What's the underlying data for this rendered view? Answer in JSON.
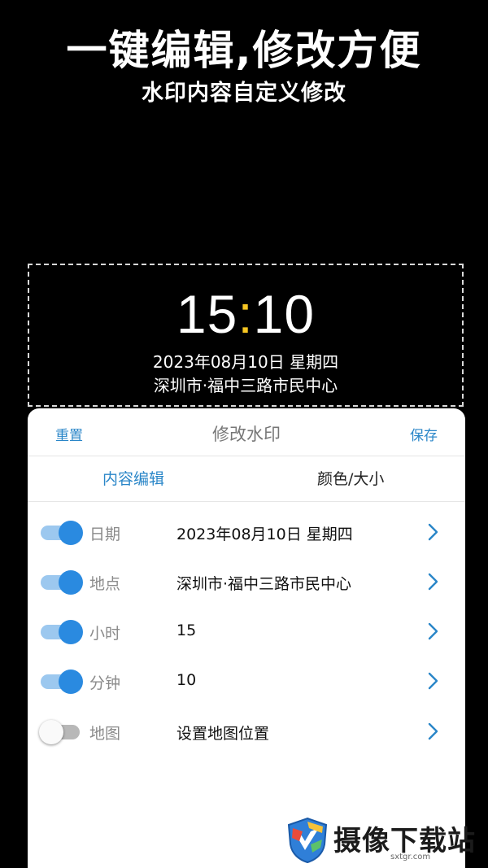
{
  "headline": "一键编辑,修改方便",
  "subheadline": "水印内容自定义修改",
  "preview": {
    "hour": "15",
    "colon": ":",
    "minute": "10",
    "date": "2023年08月10日  星期四",
    "location": "深圳市·福中三路市民中心"
  },
  "panel": {
    "reset_label": "重置",
    "title": "修改水印",
    "save_label": "保存",
    "tabs": [
      {
        "label": "内容编辑",
        "active": true
      },
      {
        "label": "颜色/大小",
        "active": false
      }
    ],
    "rows": [
      {
        "label": "日期",
        "value": "2023年08月10日  星期四",
        "enabled": true
      },
      {
        "label": "地点",
        "value": "深圳市·福中三路市民中心",
        "enabled": true
      },
      {
        "label": "小时",
        "value": "15",
        "enabled": true
      },
      {
        "label": "分钟",
        "value": "10",
        "enabled": true
      },
      {
        "label": "地图",
        "value": "设置地图位置",
        "enabled": false
      }
    ]
  },
  "brand": {
    "name": "摄像下载站",
    "url": "sxtgr.com"
  },
  "colors": {
    "accent": "#2a86c8",
    "toggle_on": "#2a8ae0",
    "toggle_track_on": "#9cc8ef",
    "colon": "#f7c622",
    "background": "#000000"
  }
}
